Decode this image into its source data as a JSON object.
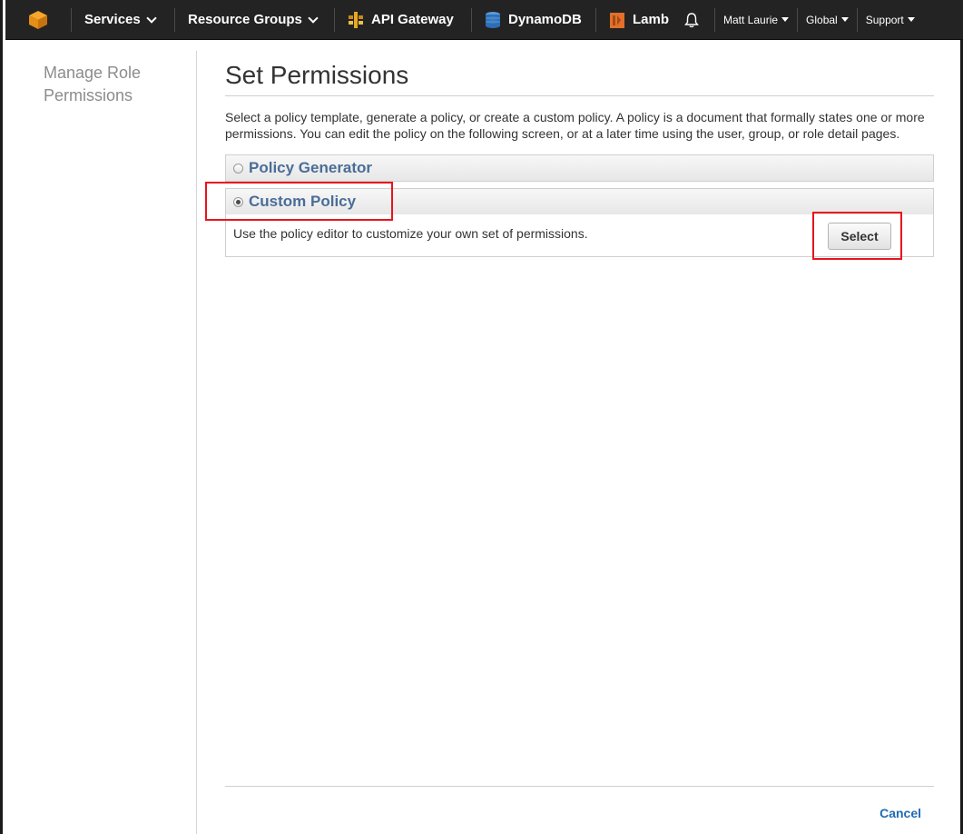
{
  "nav": {
    "services_label": "Services",
    "resource_groups_label": "Resource Groups",
    "shortcuts": [
      {
        "label": "API Gateway",
        "icon": "api-gateway-icon",
        "color": "#e7a823"
      },
      {
        "label": "DynamoDB",
        "icon": "dynamodb-icon",
        "color": "#2c6fb6"
      },
      {
        "label": "Lamb",
        "icon": "lambda-icon",
        "color": "#e2702b"
      }
    ],
    "user_label": "Matt Laurie",
    "region_label": "Global",
    "support_label": "Support"
  },
  "sidebar": {
    "title": "Manage Role Permissions"
  },
  "main": {
    "title": "Set Permissions",
    "intro": "Select a policy template, generate a policy, or create a custom policy. A policy is a document that formally states one or more permissions. You can edit the policy on the following screen, or at a later time using the user, group, or role detail pages.",
    "options": [
      {
        "label": "Policy Generator",
        "selected": false
      },
      {
        "label": "Custom Policy",
        "selected": true
      }
    ],
    "custom_description": "Use the policy editor to customize your own set of permissions.",
    "select_label": "Select",
    "cancel_label": "Cancel"
  },
  "colors": {
    "nav_bg": "#232323",
    "accent_link": "#1f6bb5",
    "panel_label": "#4a6d97",
    "highlight": "#e8141c"
  }
}
